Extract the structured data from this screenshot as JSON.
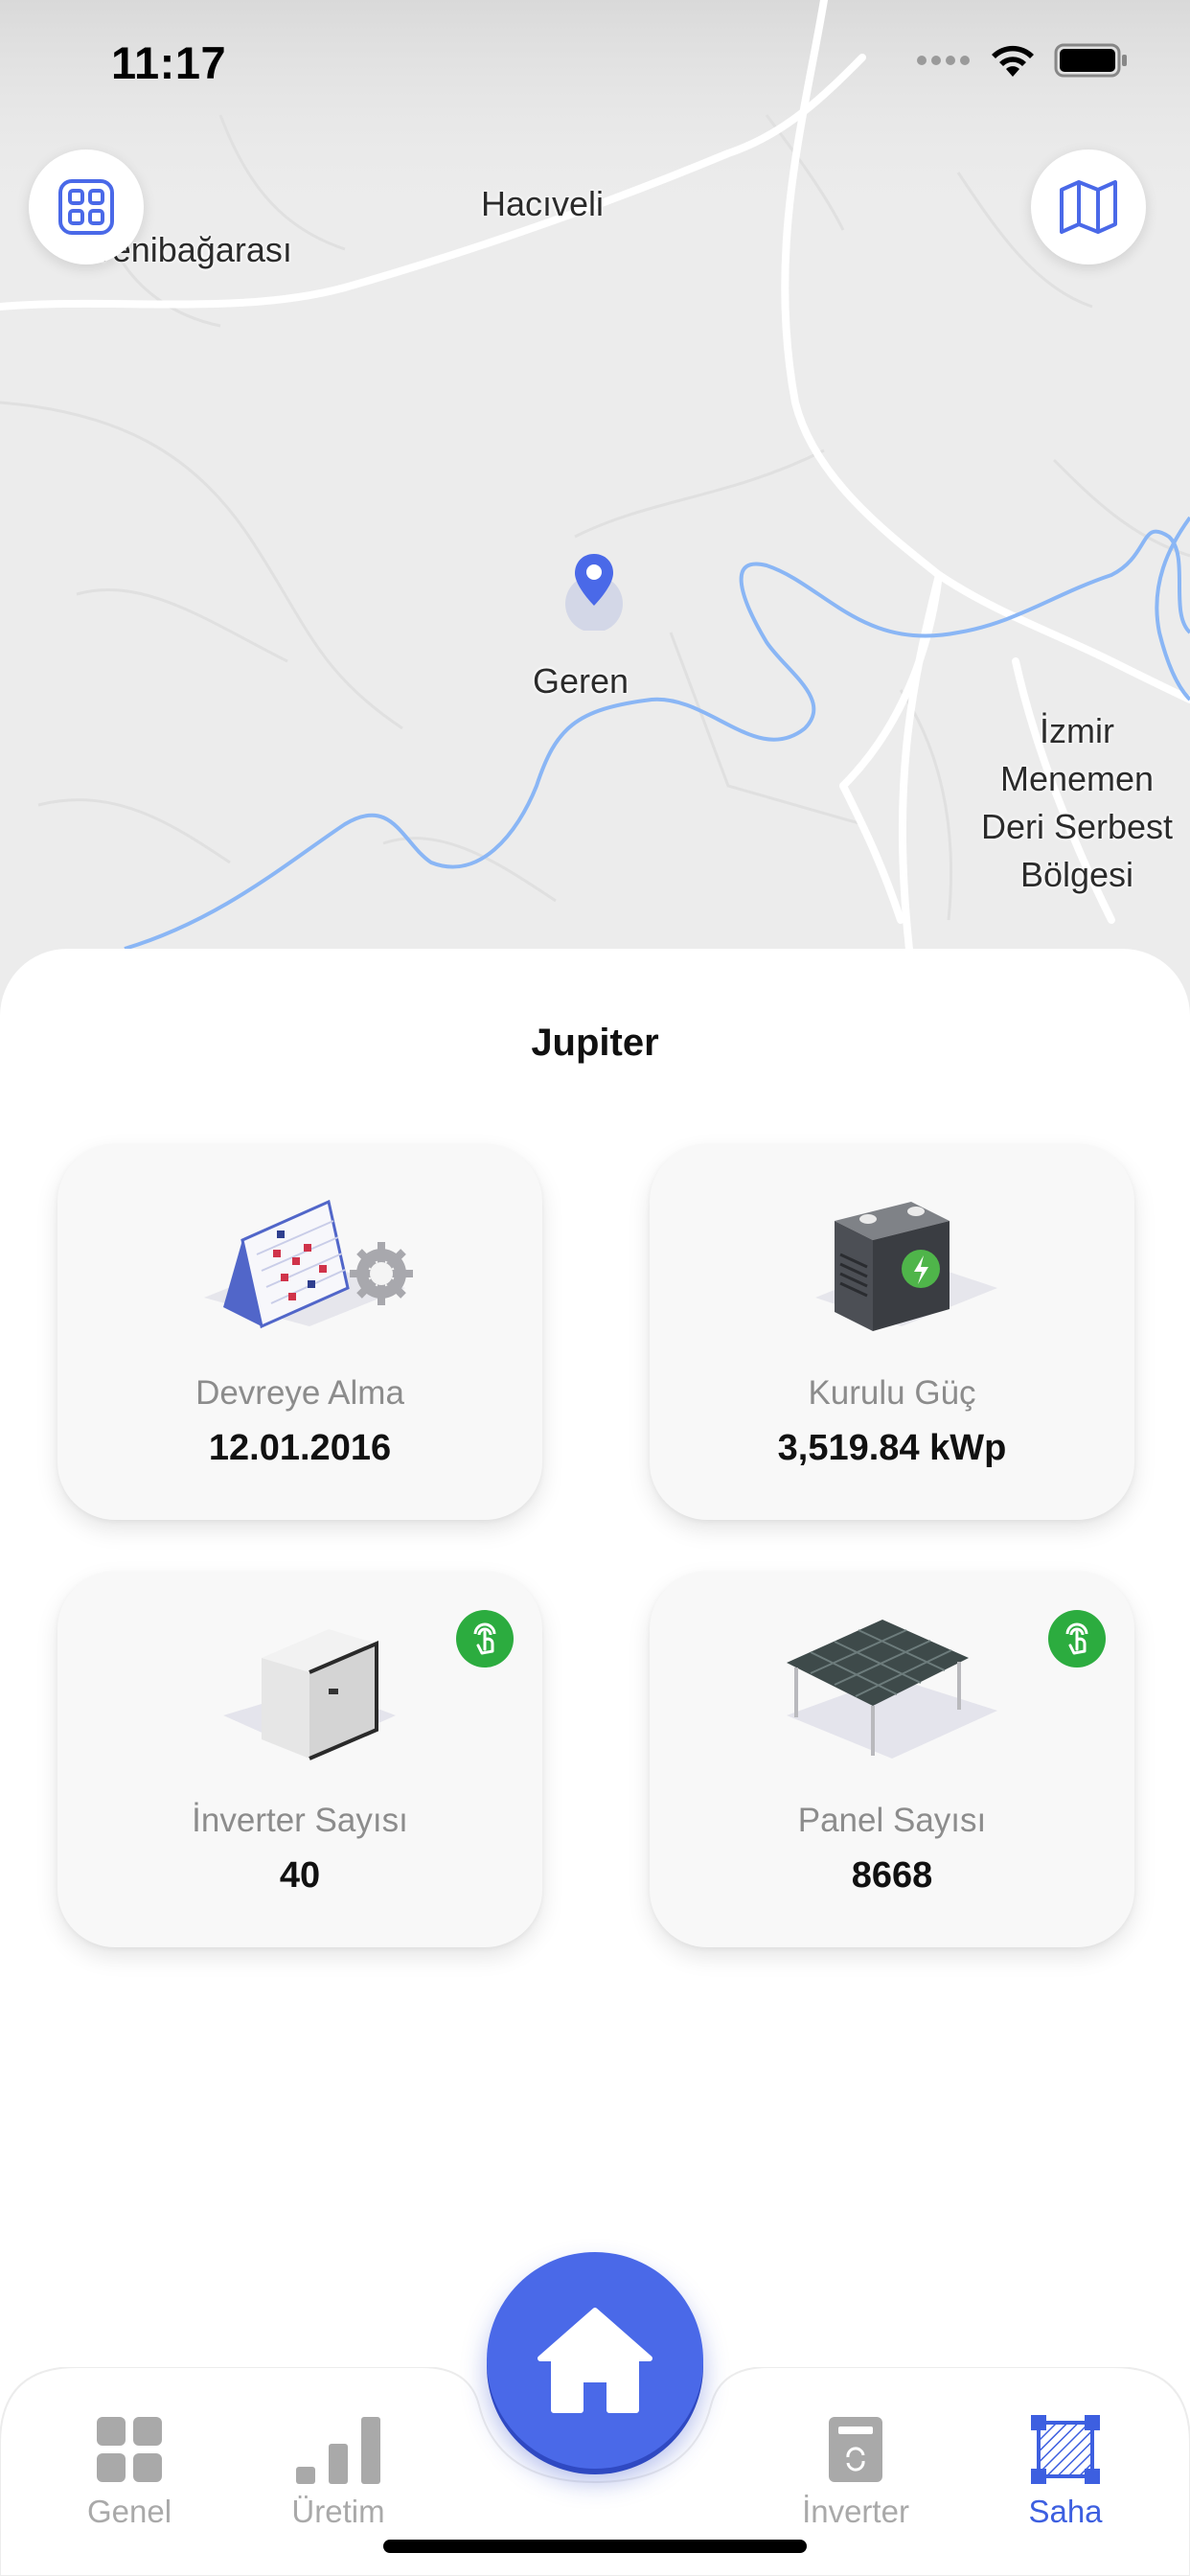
{
  "status_bar": {
    "time": "11:17",
    "icons": [
      "signal-dots-icon",
      "wifi-icon",
      "battery-icon"
    ]
  },
  "map": {
    "labels": {
      "haciveli": "Hacıveli",
      "yenibagarasi": "Yenibağarası",
      "geren": "Geren",
      "izmir_line1": "İzmir",
      "izmir_line2": "Menemen",
      "izmir_line3": "Deri Serbest",
      "izmir_line4": "Bölgesi"
    },
    "buttons": {
      "left_icon": "grid-icon",
      "right_icon": "map-icon"
    },
    "pin_icon": "location-pin-icon"
  },
  "site": {
    "title": "Jupiter"
  },
  "cards": [
    {
      "label": "Devreye Alma",
      "value": "12.01.2016",
      "icon": "calendar-gear-icon",
      "badge": false
    },
    {
      "label": "Kurulu Güç",
      "value": "3,519.84 kWp",
      "icon": "battery-box-icon",
      "badge": false
    },
    {
      "label": "İnverter Sayısı",
      "value": "40",
      "icon": "inverter-icon",
      "badge": true
    },
    {
      "label": "Panel Sayısı",
      "value": "8668",
      "icon": "solar-panel-icon",
      "badge": true
    }
  ],
  "tabbar": {
    "tabs": [
      {
        "label": "Genel",
        "icon": "grid-tab-icon",
        "active": false
      },
      {
        "label": "Üretim",
        "icon": "bar-chart-icon",
        "active": false
      },
      {
        "label": "İnverter",
        "icon": "inverter-tab-icon",
        "active": false
      },
      {
        "label": "Saha",
        "icon": "area-select-icon",
        "active": true
      }
    ],
    "home_icon": "home-icon"
  },
  "colors": {
    "accent": "#4a69e8",
    "active_tab": "#3d5fe0",
    "badge_green": "#2cac3f",
    "map_bg": "#ececec",
    "river": "#8ab6f5"
  }
}
